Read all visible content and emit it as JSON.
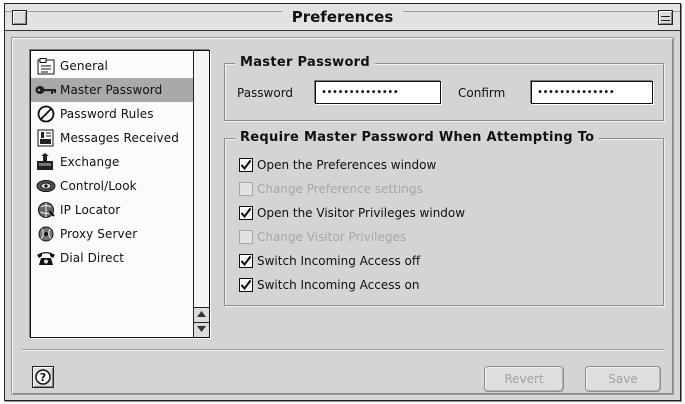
{
  "window": {
    "title": "Preferences"
  },
  "sidebar": {
    "items": [
      {
        "label": "General",
        "icon": "general-icon",
        "selected": false
      },
      {
        "label": "Master Password",
        "icon": "key-icon",
        "selected": true
      },
      {
        "label": "Password Rules",
        "icon": "no-sign-icon",
        "selected": false
      },
      {
        "label": "Messages Received",
        "icon": "messages-icon",
        "selected": false
      },
      {
        "label": "Exchange",
        "icon": "exchange-icon",
        "selected": false
      },
      {
        "label": "Control/Look",
        "icon": "control-look-icon",
        "selected": false
      },
      {
        "label": "IP Locator",
        "icon": "ip-locator-icon",
        "selected": false
      },
      {
        "label": "Proxy Server",
        "icon": "proxy-server-icon",
        "selected": false
      },
      {
        "label": "Dial Direct",
        "icon": "telephone-icon",
        "selected": false
      }
    ]
  },
  "master_password": {
    "group_title": "Master Password",
    "password_label": "Password",
    "password_value": "••••••••••••••",
    "confirm_label": "Confirm",
    "confirm_value": "••••••••••••••"
  },
  "require": {
    "group_title": "Require Master Password When Attempting To",
    "options": [
      {
        "label": "Open the Preferences window",
        "checked": true,
        "enabled": true
      },
      {
        "label": "Change Preference settings",
        "checked": false,
        "enabled": false
      },
      {
        "label": "Open the Visitor Privileges window",
        "checked": true,
        "enabled": true
      },
      {
        "label": "Change Visitor Privileges",
        "checked": false,
        "enabled": false
      },
      {
        "label": "Switch Incoming Access off",
        "checked": true,
        "enabled": true
      },
      {
        "label": "Switch Incoming Access on",
        "checked": true,
        "enabled": true
      }
    ]
  },
  "buttons": {
    "help_label": "?",
    "revert_label": "Revert",
    "save_label": "Save"
  }
}
